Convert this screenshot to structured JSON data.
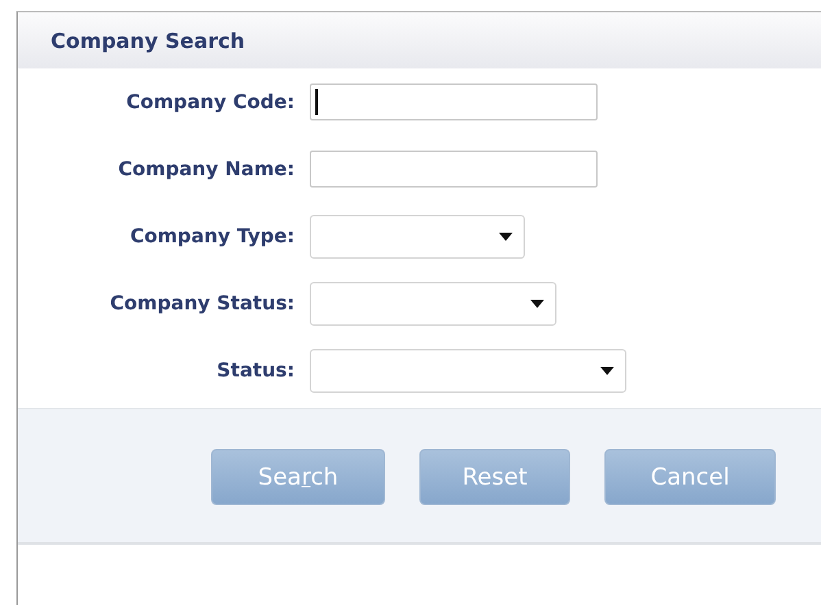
{
  "panel": {
    "title": "Company Search"
  },
  "fields": [
    {
      "label": "Company Code:",
      "kind": "text",
      "focused": true
    },
    {
      "label": "Company Name:",
      "kind": "text",
      "focused": false
    },
    {
      "label": "Company Type:",
      "kind": "select",
      "focused": false
    },
    {
      "label": "Company Status:",
      "kind": "select",
      "focused": false
    },
    {
      "label": "Status:",
      "kind": "select",
      "focused": false
    }
  ],
  "buttons": [
    {
      "label_before": "Sea",
      "label_key": "r",
      "label_after": "ch"
    },
    {
      "label_before": "Reset"
    },
    {
      "label_before": "Cancel"
    }
  ]
}
